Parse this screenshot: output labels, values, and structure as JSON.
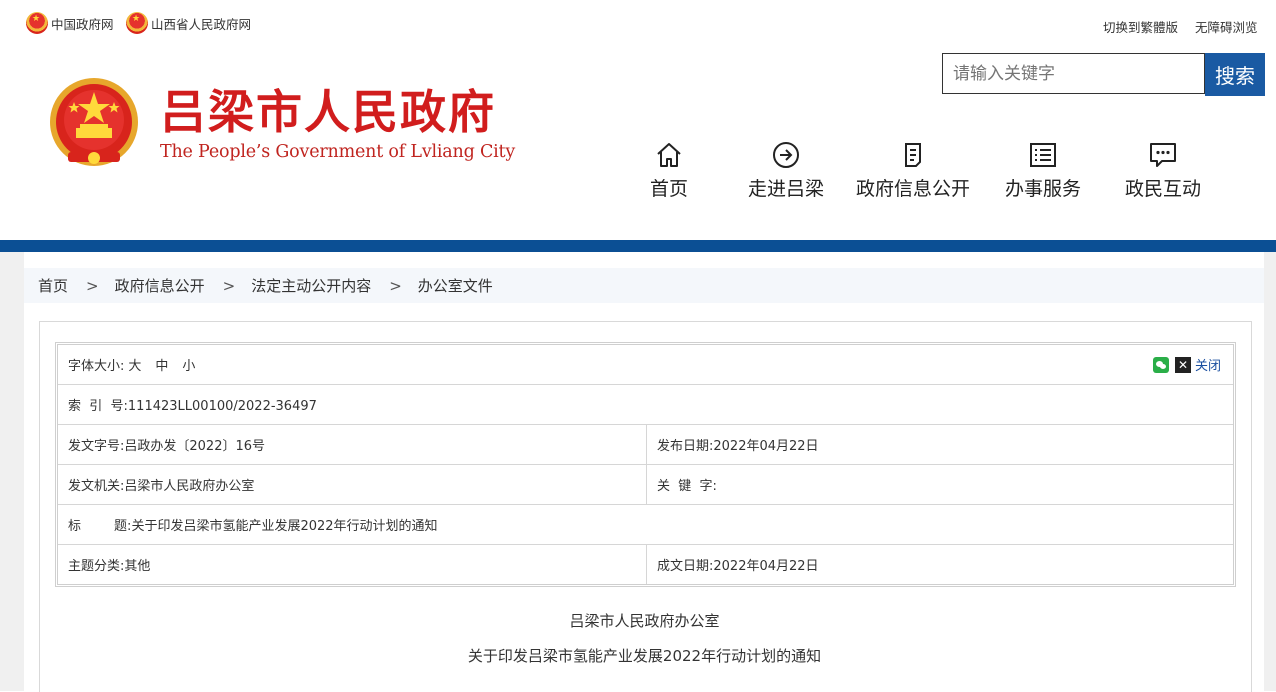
{
  "topbar": {
    "left_links": [
      "中国政府网",
      "山西省人民政府网"
    ],
    "traditional": "切换到繁體版",
    "accessibility": "无障碍浏览"
  },
  "header": {
    "title": "吕梁市人民政府",
    "subtitle": "The People’s Government of Lvliang City",
    "search_placeholder": "请输入关键字",
    "search_button": "搜索"
  },
  "nav": [
    {
      "label": "首页",
      "icon": "home-icon"
    },
    {
      "label": "走进吕梁",
      "icon": "arrow-circle-icon"
    },
    {
      "label": "政府信息公开",
      "icon": "document-icon"
    },
    {
      "label": "办事服务",
      "icon": "list-icon"
    },
    {
      "label": "政民互动",
      "icon": "chat-icon"
    }
  ],
  "breadcrumb": [
    "首页",
    "政府信息公开",
    "法定主动公开内容",
    "办公室文件"
  ],
  "meta": {
    "font_size_label": "字体大小:",
    "font_sizes": [
      "大",
      "中",
      "小"
    ],
    "close_label": "关闭",
    "index_no": "索  引  号:111423LL00100/2022-36497",
    "doc_no": "发文字号:吕政办发〔2022〕16号",
    "publish_date": "发布日期:2022年04月22日",
    "issuer": "发文机关:吕梁市人民政府办公室",
    "keywords": "关  键  字:",
    "title": "标        题:关于印发吕梁市氢能产业发展2022年行动计划的通知",
    "category": "主题分类:其他",
    "written_date": "成文日期:2022年04月22日"
  },
  "document": {
    "issuer": "吕梁市人民政府办公室",
    "title": "关于印发吕梁市氢能产业发展2022年行动计划的通知"
  },
  "colors": {
    "brand_red": "#d11d1d",
    "nav_blue": "#0b4f94",
    "search_blue": "#1a5aa3"
  }
}
